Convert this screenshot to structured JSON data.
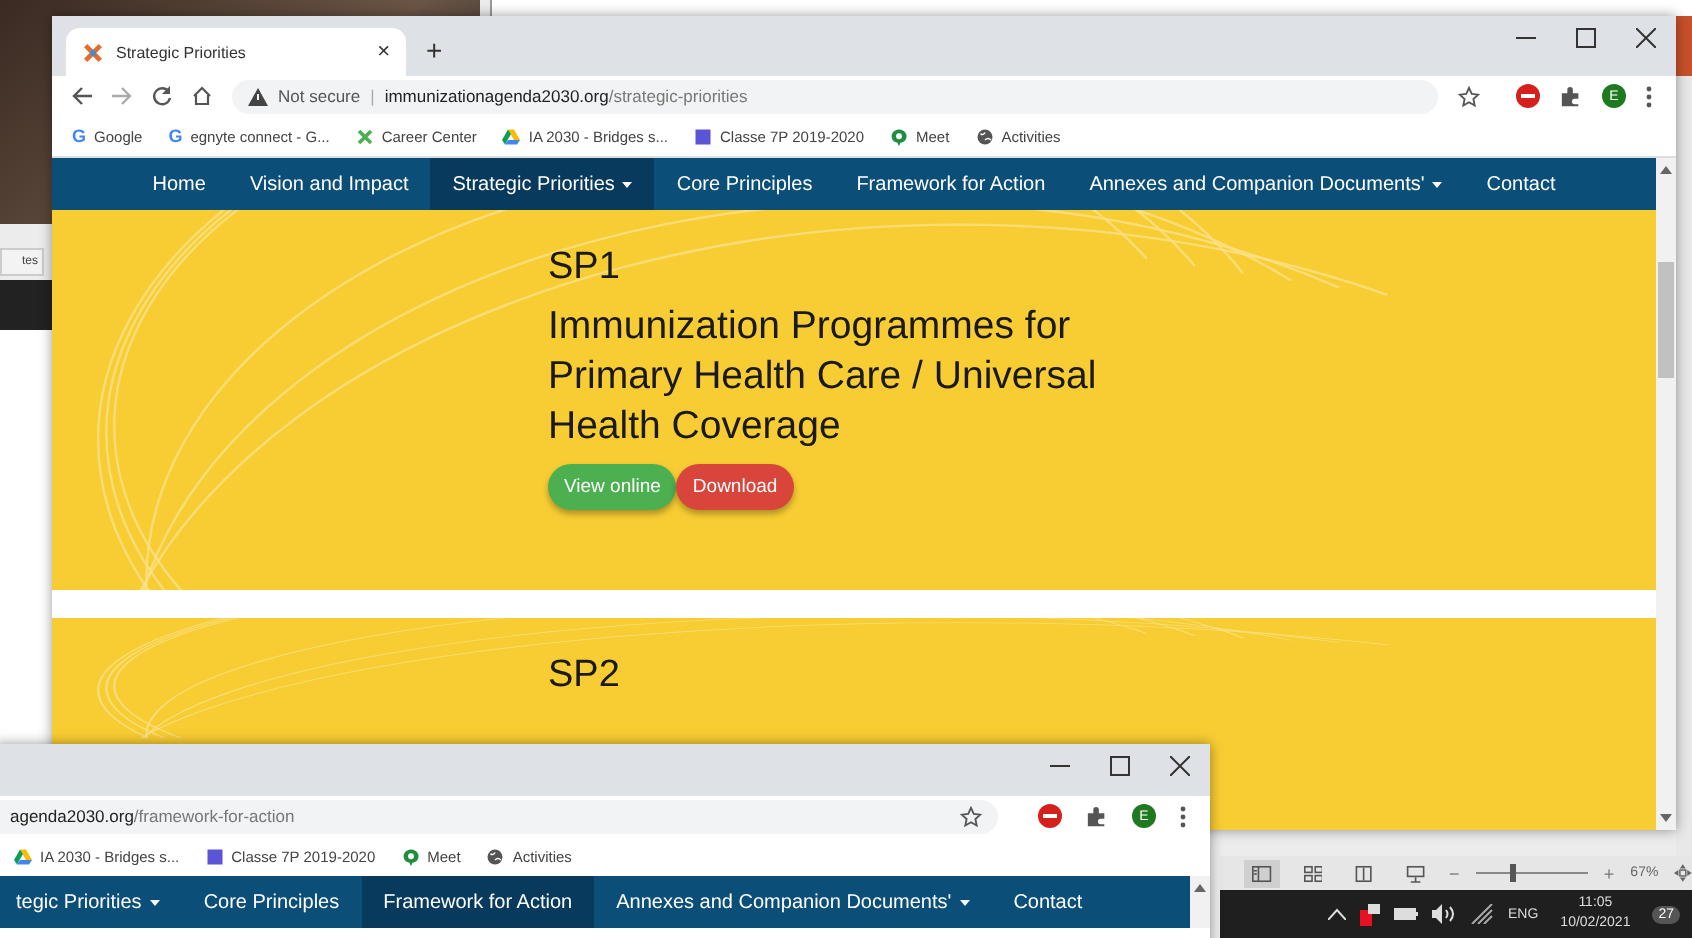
{
  "background": {
    "side_button": "tes"
  },
  "main_window": {
    "tab": {
      "title": "Strategic Priorities",
      "close": "×"
    },
    "new_tab": "+",
    "address": {
      "warning": "Not secure",
      "separator": "|",
      "host": "immunizationagenda2030.org",
      "path": "/strategic-priorities"
    },
    "profile_initial": "E",
    "bookmarks": [
      {
        "label": "Google",
        "kind": "google",
        "icon": "G"
      },
      {
        "label": "egnyte connect - G...",
        "kind": "google",
        "icon": "G"
      },
      {
        "label": "Career Center",
        "kind": "cross"
      },
      {
        "label": "IA 2030 - Bridges s...",
        "kind": "drive"
      },
      {
        "label": "Classe 7P 2019-2020",
        "kind": "square"
      },
      {
        "label": "Meet",
        "kind": "meet"
      },
      {
        "label": "Activities",
        "kind": "globe"
      }
    ],
    "nav": [
      {
        "label": "Home",
        "selected": false,
        "dropdown": false
      },
      {
        "label": "Vision and Impact",
        "selected": false,
        "dropdown": false
      },
      {
        "label": "Strategic Priorities",
        "selected": true,
        "dropdown": true
      },
      {
        "label": "Core Principles",
        "selected": false,
        "dropdown": false
      },
      {
        "label": "Framework for Action",
        "selected": false,
        "dropdown": false
      },
      {
        "label": "Annexes and Companion Documents'",
        "selected": false,
        "dropdown": true
      },
      {
        "label": "Contact",
        "selected": false,
        "dropdown": false
      }
    ],
    "sections": [
      {
        "code": "SP1",
        "title": "Immunization Programmes for Primary Health Care / Universal Health Coverage",
        "buttons": [
          {
            "label": "View online",
            "kind": "view"
          },
          {
            "label": "Download",
            "kind": "download"
          }
        ]
      },
      {
        "code": "SP2"
      }
    ]
  },
  "second_window": {
    "address": {
      "host": "agenda2030.org",
      "path": "/framework-for-action"
    },
    "profile_initial": "E",
    "bookmarks": [
      {
        "label": "IA 2030 - Bridges s...",
        "kind": "drive"
      },
      {
        "label": "Classe 7P 2019-2020",
        "kind": "square"
      },
      {
        "label": "Meet",
        "kind": "meet"
      },
      {
        "label": "Activities",
        "kind": "globe"
      }
    ],
    "nav": [
      {
        "label": "tegic Priorities",
        "selected": false,
        "dropdown": true
      },
      {
        "label": "Core Principles",
        "selected": false,
        "dropdown": false
      },
      {
        "label": "Framework for Action",
        "selected": true,
        "dropdown": false
      },
      {
        "label": "Annexes and Companion Documents'",
        "selected": false,
        "dropdown": true
      },
      {
        "label": "Contact",
        "selected": false,
        "dropdown": false
      }
    ]
  },
  "status_bar": {
    "minus": "−",
    "plus": "+",
    "zoom": {
      "level": 0.32
    },
    "zoom_text": "67%"
  },
  "taskbar": {
    "language": "ENG",
    "time": "11:05",
    "date": "10/02/2021",
    "notifications": "27"
  }
}
